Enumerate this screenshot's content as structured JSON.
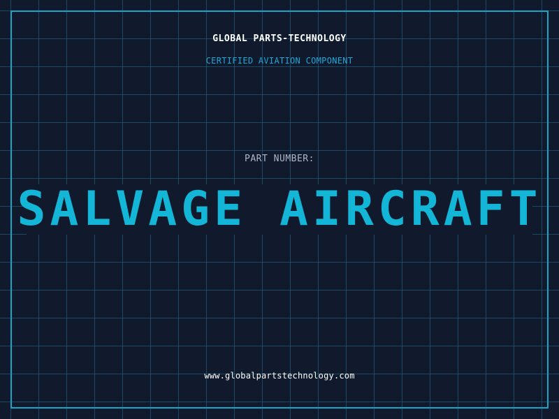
{
  "header": {
    "company": "GLOBAL PARTS-TECHNOLOGY",
    "subtitle": "CERTIFIED AVIATION COMPONENT"
  },
  "part": {
    "label": "PART NUMBER:",
    "number": "SALVAGE AIRCRAFT"
  },
  "footer": {
    "website": "www.globalpartstechnology.com"
  },
  "colors": {
    "background": "#111a2d",
    "grid": "#1f6f8a",
    "accent": "#13b6d6",
    "frame": "#16a6c9",
    "text": "#ffffff",
    "muted": "#aeb7c8"
  }
}
